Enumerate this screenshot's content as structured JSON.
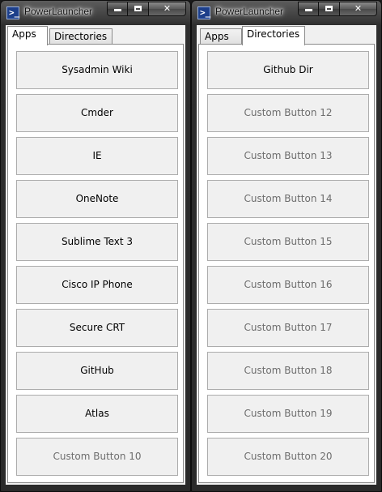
{
  "windows": [
    {
      "title": "PowerLauncher",
      "icon": "powershell-icon",
      "tabs": [
        {
          "label": "Apps",
          "active": true
        },
        {
          "label": "Directories",
          "active": false
        }
      ],
      "buttons": [
        {
          "label": "Sysadmin Wiki",
          "custom": false
        },
        {
          "label": "Cmder",
          "custom": false
        },
        {
          "label": "IE",
          "custom": false
        },
        {
          "label": "OneNote",
          "custom": false
        },
        {
          "label": "Sublime Text 3",
          "custom": false
        },
        {
          "label": "Cisco IP Phone",
          "custom": false
        },
        {
          "label": "Secure CRT",
          "custom": false
        },
        {
          "label": "GitHub",
          "custom": false
        },
        {
          "label": "Atlas",
          "custom": false
        },
        {
          "label": "Custom Button 10",
          "custom": true
        }
      ]
    },
    {
      "title": "PowerLauncher",
      "icon": "powershell-icon",
      "tabs": [
        {
          "label": "Apps",
          "active": false
        },
        {
          "label": "Directories",
          "active": true
        }
      ],
      "buttons": [
        {
          "label": "Github Dir",
          "custom": false
        },
        {
          "label": "Custom Button 12",
          "custom": true
        },
        {
          "label": "Custom Button 13",
          "custom": true
        },
        {
          "label": "Custom Button 14",
          "custom": true
        },
        {
          "label": "Custom Button 15",
          "custom": true
        },
        {
          "label": "Custom Button 16",
          "custom": true
        },
        {
          "label": "Custom Button 17",
          "custom": true
        },
        {
          "label": "Custom Button 18",
          "custom": true
        },
        {
          "label": "Custom Button 19",
          "custom": true
        },
        {
          "label": "Custom Button 20",
          "custom": true
        }
      ]
    }
  ],
  "colors": {
    "button_face": "#f0f0f0",
    "button_text": "#000000",
    "custom_button_text": "#6d6d6d",
    "titlebar": "#3a3a3a"
  }
}
